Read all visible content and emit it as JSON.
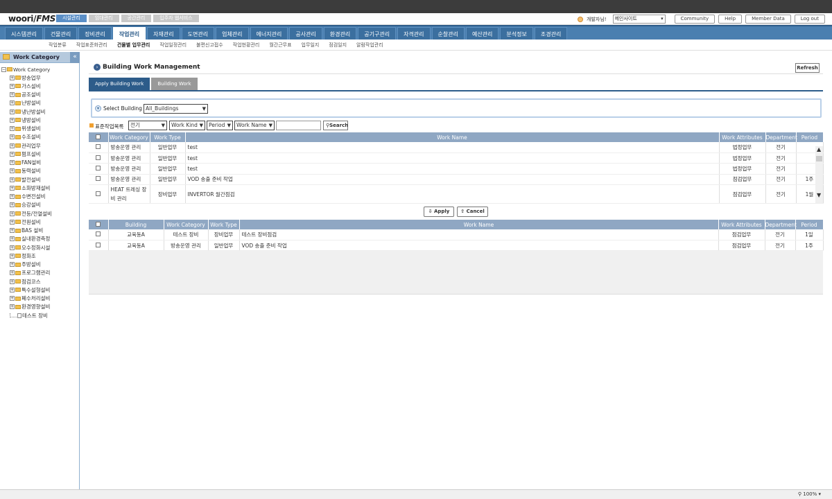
{
  "header": {
    "logo_main": "woori",
    "logo_sub": "FMS",
    "system_tabs": [
      {
        "label": "시설관리",
        "active": true
      },
      {
        "label": "임대관리",
        "active": false
      },
      {
        "label": "공간관리",
        "active": false
      },
      {
        "label": "입주자 웹서비스",
        "active": false
      }
    ],
    "user_greeting": "개발자님!",
    "site_select": "메인사이트",
    "buttons": [
      "Community",
      "Help",
      "Member Data",
      "Log out"
    ]
  },
  "main_nav": [
    {
      "label": "시스템관리"
    },
    {
      "label": "건물관리"
    },
    {
      "label": "장비관리"
    },
    {
      "label": "작업관리",
      "active": true
    },
    {
      "label": "자재관리"
    },
    {
      "label": "도면관리"
    },
    {
      "label": "업체관리"
    },
    {
      "label": "에너지관리"
    },
    {
      "label": "공사관리"
    },
    {
      "label": "환경관리"
    },
    {
      "label": "공기구관리"
    },
    {
      "label": "자격관리"
    },
    {
      "label": "순찰관리"
    },
    {
      "label": "예산관리"
    },
    {
      "label": "분석정보"
    },
    {
      "label": "조경관리"
    }
  ],
  "sub_nav": [
    {
      "label": "작업분류"
    },
    {
      "label": "작업표준화관리"
    },
    {
      "label": "건물별 업무관리",
      "active": true
    },
    {
      "label": "작업일정관리"
    },
    {
      "label": "불편신고접수"
    },
    {
      "label": "작업현황관리"
    },
    {
      "label": "월간근무표"
    },
    {
      "label": "업무일지"
    },
    {
      "label": "점검일지"
    },
    {
      "label": "알람작업관리"
    }
  ],
  "sidebar": {
    "title": "Work Category",
    "collapse_icon": "«",
    "root": "Work Category",
    "items": [
      "방송업무",
      "가스설비",
      "공조설비",
      "난방설비",
      "냉난방설비",
      "냉방설비",
      "위생설비",
      "수조설비",
      "관리업무",
      "펌프설비",
      "FAN설비",
      "동력설비",
      "발전설비",
      "소화방재설비",
      "수변전설비",
      "승강설비",
      "전등/전열설비",
      "전원설비",
      "BAS 설비",
      "실내환경측정",
      "오수정화시설",
      "정화조",
      "주방설비",
      "프로그램관리",
      "점검코스",
      "특수설형설비",
      "폐수처리설비",
      "환경영향설비"
    ],
    "leaf": "테스트 장비"
  },
  "page": {
    "title": "Building Work Management",
    "refresh": "Refresh",
    "tabs": [
      {
        "label": "Apply Building Work",
        "active": true
      },
      {
        "label": "Building Work",
        "active": false
      }
    ],
    "select_building_label": "Select Building",
    "select_building_value": "All_Buildings"
  },
  "filter": {
    "label": "표준작업목록",
    "category": "전기",
    "work_kind": "Work Kind",
    "period": "Period",
    "work_name": "Work Name",
    "search_value": "",
    "search_btn": "Search"
  },
  "upper_table": {
    "headers": [
      "Work Category",
      "Work Type",
      "Work Name",
      "Work Attributes",
      "Department",
      "Period"
    ],
    "rows": [
      {
        "category": "방송운영 관리",
        "type": "일반업무",
        "name": "test",
        "attr": "법정업무",
        "dept": "전기",
        "period": ""
      },
      {
        "category": "방송운영 관리",
        "type": "일반업무",
        "name": "test",
        "attr": "법정업무",
        "dept": "전기",
        "period": ""
      },
      {
        "category": "방송운영 관리",
        "type": "일반업무",
        "name": "test",
        "attr": "법정업무",
        "dept": "전기",
        "period": ""
      },
      {
        "category": "방송운영 관리",
        "type": "일반업무",
        "name": "VOD 송출 준비 작업",
        "attr": "점검업무",
        "dept": "전기",
        "period": "1주"
      },
      {
        "category": "HEAT 트레싱 장비 관리",
        "type": "장비업무",
        "name": "INVERTOR 월간점검",
        "attr": "점검업무",
        "dept": "전기",
        "period": "1월"
      }
    ]
  },
  "actions": {
    "apply": "Apply",
    "cancel": "Cancel"
  },
  "lower_table": {
    "headers": [
      "Building",
      "Work Category",
      "Work Type",
      "Work Name",
      "Work Attributes",
      "Department",
      "Period"
    ],
    "rows": [
      {
        "building": "교육동A",
        "category": "테스트 장비",
        "type": "장비업무",
        "name": "테스트 장비점검",
        "attr": "점검업무",
        "dept": "전기",
        "period": "1일"
      },
      {
        "building": "교육동A",
        "category": "방송운영 관리",
        "type": "일반업무",
        "name": "VOD 송출 준비 작업",
        "attr": "점검업무",
        "dept": "전기",
        "period": "1주"
      }
    ]
  },
  "status": {
    "zoom": "100%"
  }
}
